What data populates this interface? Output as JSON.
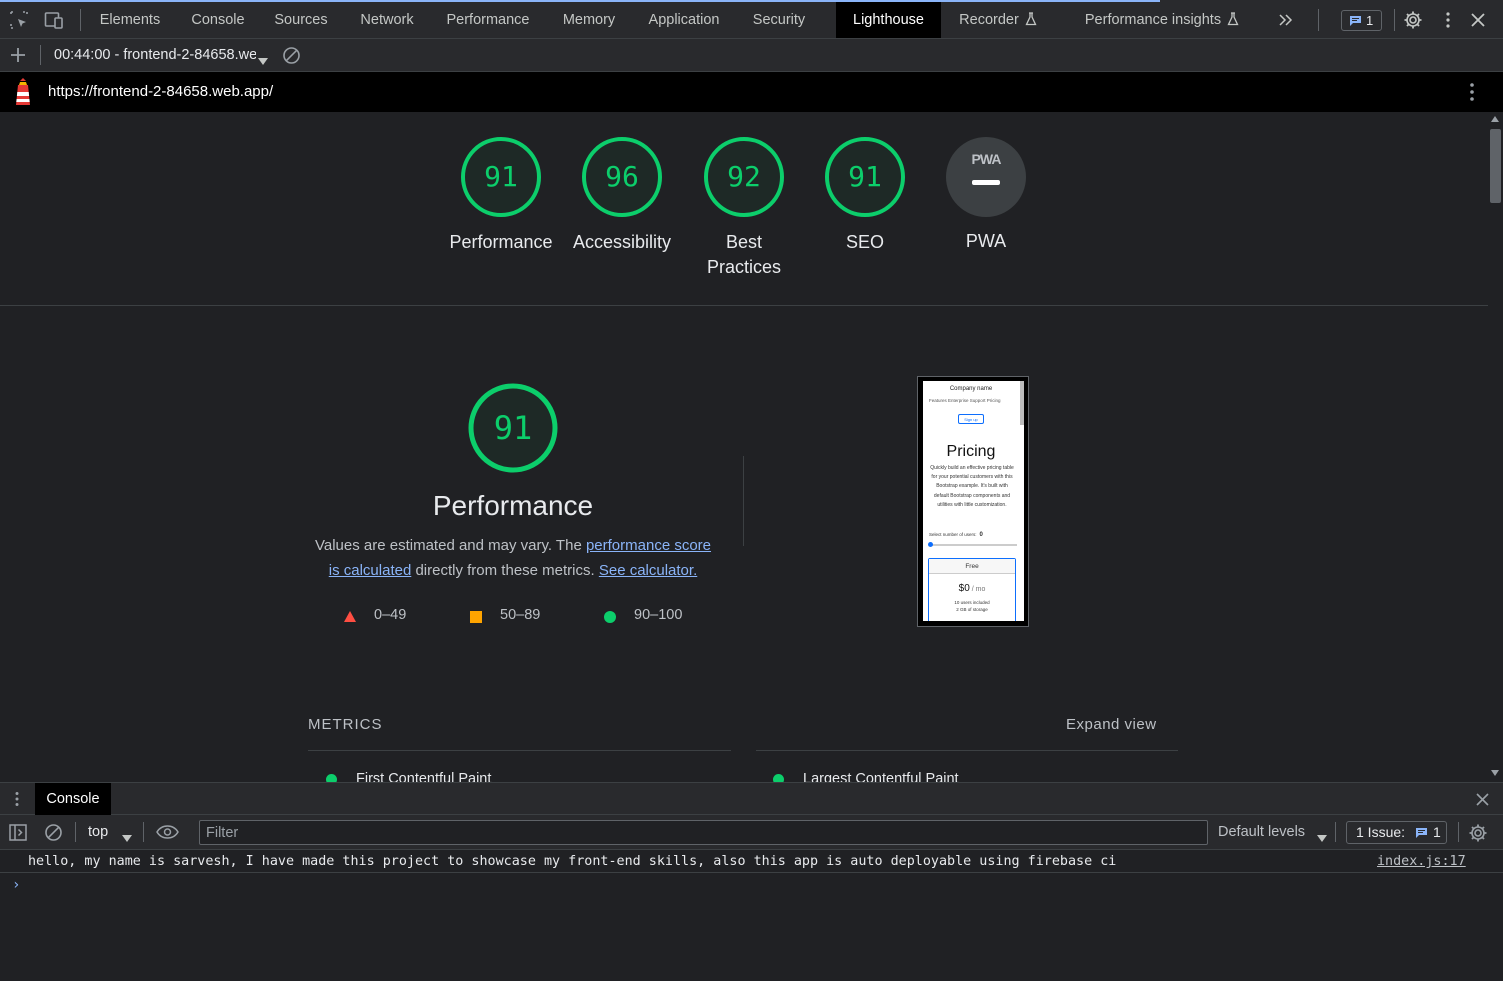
{
  "devtools": {
    "tabs": [
      {
        "label": "Elements"
      },
      {
        "label": "Console"
      },
      {
        "label": "Sources"
      },
      {
        "label": "Network"
      },
      {
        "label": "Performance"
      },
      {
        "label": "Memory"
      },
      {
        "label": "Application"
      },
      {
        "label": "Security"
      },
      {
        "label": "Lighthouse"
      },
      {
        "label": "Recorder"
      },
      {
        "label": "Performance insights"
      }
    ],
    "active_tab": "Lighthouse",
    "issues_count": "1"
  },
  "lighthouse": {
    "report_select": "00:44:00 - frontend-2-84658.web.app",
    "url": "https://frontend-2-84658.web.app/",
    "gauges": [
      {
        "score": "91",
        "label": "Performance",
        "value": 91
      },
      {
        "score": "96",
        "label": "Accessibility",
        "value": 96
      },
      {
        "score": "92",
        "label": "Best Practices",
        "value": 92
      },
      {
        "score": "91",
        "label": "SEO",
        "value": 91
      },
      {
        "score": "PWA",
        "label": "PWA"
      }
    ],
    "performance": {
      "score": "91",
      "value": 91,
      "title": "Performance",
      "desc_pre": "Values are estimated and may vary. The ",
      "desc_link": "performance score is calculated",
      "desc_mid": " directly from these metrics. ",
      "desc_link2": "See calculator.",
      "legend": [
        "0–49",
        "50–89",
        "90–100"
      ]
    },
    "screenshot": {
      "company": "Company name",
      "nav": "Features   Enterprise   Support   Pricing",
      "signup": "Sign up",
      "title": "Pricing",
      "desc": "Quickly build an effective pricing table for your potential customers with this Bootstrap example. It's built with default Bootstrap components and utilities with little customization.",
      "select_label": "Select number of users:",
      "select_value": "0",
      "card_title": "Free",
      "price": "$0",
      "price_unit": " / mo",
      "line1": "10 users included",
      "line2": "2 GB of storage"
    },
    "metrics": {
      "title": "METRICS",
      "expand": "Expand view",
      "items": [
        "First Contentful Paint",
        "Largest Contentful Paint"
      ]
    }
  },
  "drawer": {
    "tab": "Console",
    "context": "top",
    "filter_placeholder": "Filter",
    "levels": "Default levels",
    "issues_label": "1 Issue:",
    "issues_count": "1",
    "log_message": "hello, my name is sarvesh, I have made this project to showcase my front-end skills, also this app is auto deployable using firebase ci",
    "log_source": "index.js:17",
    "prompt": "›"
  },
  "colors": {
    "pass": "#0cce6b",
    "average": "#ffa400",
    "fail": "#ff4e42",
    "link": "#8ab4f8"
  }
}
